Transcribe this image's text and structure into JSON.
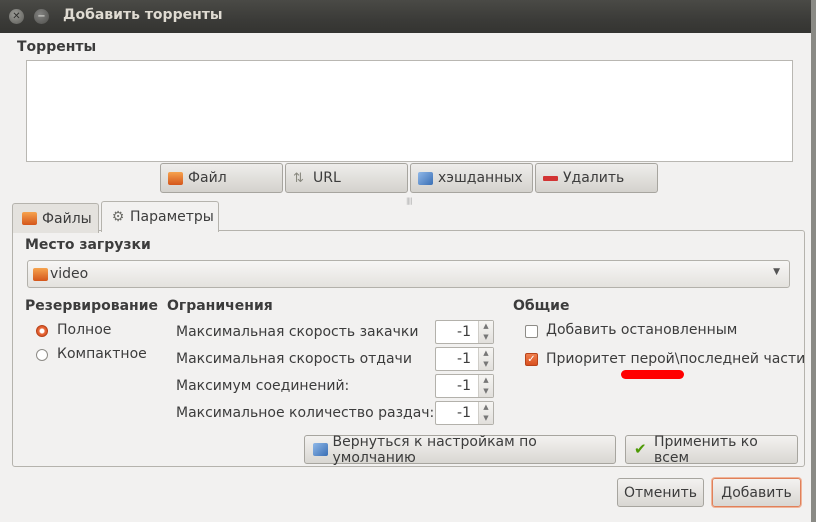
{
  "window": {
    "title": "Добавить торренты"
  },
  "torrents": {
    "label": "Торренты",
    "buttons": {
      "file": "Файл",
      "url": "URL",
      "hash": "хэшданных",
      "remove": "Удалить"
    }
  },
  "tabs": {
    "files": "Файлы",
    "params": "Параметры"
  },
  "destination": {
    "label": "Место загрузки",
    "value": "video"
  },
  "allocation": {
    "label": "Резервирование",
    "full": "Полное",
    "compact": "Компактное",
    "selected": "full"
  },
  "limits": {
    "label": "Ограничения",
    "rows": [
      {
        "label": "Максимальная скорость закачки",
        "value": "-1"
      },
      {
        "label": "Максимальная скорость отдачи",
        "value": "-1"
      },
      {
        "label": "Максимум соединений:",
        "value": "-1"
      },
      {
        "label": "Максимальное количество раздач:",
        "value": "-1"
      }
    ]
  },
  "general": {
    "label": "Общие",
    "add_paused": {
      "label": "Добавить остановленным",
      "checked": false
    },
    "prioritize": {
      "label": "Приоритет перой\\последней части",
      "checked": true
    }
  },
  "actions": {
    "revert": "Вернуться к настройкам по умолчанию",
    "apply_all": "Применить ко всем"
  },
  "dialog": {
    "cancel": "Отменить",
    "add": "Добавить"
  },
  "colors": {
    "accent": "#d9501f",
    "annotation": "#ff0000"
  }
}
